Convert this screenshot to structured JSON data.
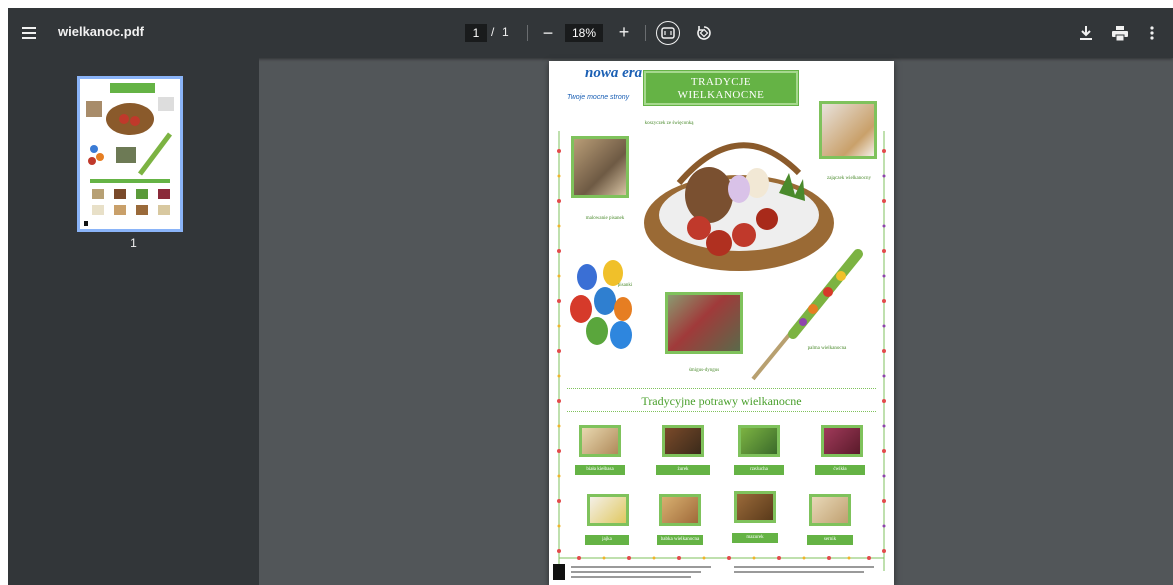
{
  "toolbar": {
    "title": "wielkanoc.pdf",
    "current_page": "1",
    "page_separator": "/",
    "total_pages": "1",
    "zoom_out_label": "−",
    "zoom_level": "18%",
    "zoom_in_label": "+"
  },
  "sidebar": {
    "thumbnails": [
      {
        "page_number": "1"
      }
    ]
  },
  "document": {
    "logo": "nowa era",
    "logo_tagline": "Twoje mocne strony",
    "title_line1": "TRADYCJE",
    "title_line2": "WIELKANOCNE",
    "captions": {
      "basket": "koszyczek ze święconką",
      "painting": "malowanie pisanek",
      "bunny": "zajączek wielkanocny",
      "eggs": "pisanki",
      "dyngus": "śmigus-dyngus",
      "palm": "palma wielkanocna"
    },
    "section_title": "Tradycyjne potrawy wielkanocne",
    "foods": [
      "biała kiełbasa",
      "żurek",
      "rzeżucha",
      "ćwikła",
      "jajka",
      "babka wielkanocna",
      "mazurek",
      "sernik"
    ]
  },
  "colors": {
    "toolbar_bg": "#323639",
    "viewer_bg": "#525659",
    "thumb_highlight": "#8ab4f8",
    "poster_green": "#65b345"
  },
  "icons": {
    "menu": "menu-icon",
    "fit": "fit-to-page-icon",
    "rotate": "rotate-icon",
    "download": "download-icon",
    "print": "print-icon",
    "more": "more-vertical-icon"
  }
}
